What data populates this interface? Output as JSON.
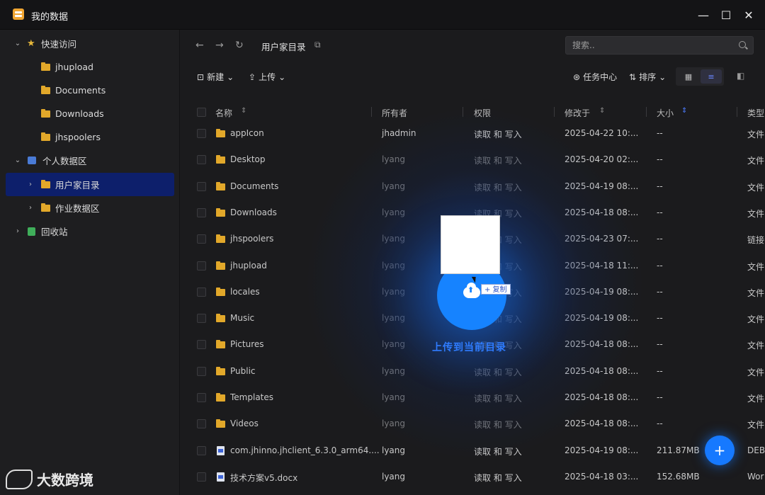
{
  "window": {
    "title": "我的数据"
  },
  "sidebar": {
    "quick": {
      "label": "快速访问"
    },
    "quick_items": [
      "jhupload",
      "Documents",
      "Downloads",
      "jhspoolers"
    ],
    "personal": {
      "label": "个人数据区"
    },
    "personal_items": [
      "用户家目录",
      "作业数据区"
    ],
    "trash": {
      "label": "回收站"
    }
  },
  "toolbar": {
    "breadcrumb": "用户家目录",
    "search_placeholder": "搜索..",
    "new_label": "新建",
    "upload_label": "上传",
    "tasks_label": "任务中心",
    "sort_label": "排序"
  },
  "table": {
    "headers": {
      "name": "名称",
      "owner": "所有者",
      "perm": "权限",
      "modified": "修改于",
      "size": "大小",
      "type": "类型"
    },
    "rows": [
      {
        "name": "appIcon",
        "owner": "jhadmin",
        "perm": "读取 和 写入",
        "modified": "2025-04-22 10:...",
        "size": "--",
        "type": "文件"
      },
      {
        "name": "Desktop",
        "owner": "lyang",
        "perm": "读取 和 写入",
        "modified": "2025-04-20 02:...",
        "size": "--",
        "type": "文件"
      },
      {
        "name": "Documents",
        "owner": "lyang",
        "perm": "读取 和 写入",
        "modified": "2025-04-19 08:...",
        "size": "--",
        "type": "文件"
      },
      {
        "name": "Downloads",
        "owner": "lyang",
        "perm": "读取 和 写入",
        "modified": "2025-04-18 08:...",
        "size": "--",
        "type": "文件"
      },
      {
        "name": "jhspoolers",
        "owner": "lyang",
        "perm": "读取 和 写入",
        "modified": "2025-04-23 07:...",
        "size": "--",
        "type": "链接"
      },
      {
        "name": "jhupload",
        "owner": "lyang",
        "perm": "读取 和 写入",
        "modified": "2025-04-18 11:...",
        "size": "--",
        "type": "文件"
      },
      {
        "name": "locales",
        "owner": "lyang",
        "perm": "读取 和 写入",
        "modified": "2025-04-19 08:...",
        "size": "--",
        "type": "文件"
      },
      {
        "name": "Music",
        "owner": "lyang",
        "perm": "读取 和 写入",
        "modified": "2025-04-19 08:...",
        "size": "--",
        "type": "文件"
      },
      {
        "name": "Pictures",
        "owner": "lyang",
        "perm": "读取 和 写入",
        "modified": "2025-04-18 08:...",
        "size": "--",
        "type": "文件"
      },
      {
        "name": "Public",
        "owner": "lyang",
        "perm": "读取 和 写入",
        "modified": "2025-04-18 08:...",
        "size": "--",
        "type": "文件"
      },
      {
        "name": "Templates",
        "owner": "lyang",
        "perm": "读取 和 写入",
        "modified": "2025-04-18 08:...",
        "size": "--",
        "type": "文件"
      },
      {
        "name": "Videos",
        "owner": "lyang",
        "perm": "读取 和 写入",
        "modified": "2025-04-18 08:...",
        "size": "--",
        "type": "文件"
      },
      {
        "name": "com.jhinno.jhclient_6.3.0_arm64....",
        "owner": "lyang",
        "perm": "读取 和 写入",
        "modified": "2025-04-19 08:...",
        "size": "211.87MB",
        "type": "DEB"
      },
      {
        "name": "技术方案v5.docx",
        "owner": "lyang",
        "perm": "读取 和 写入",
        "modified": "2025-04-18 03:...",
        "size": "152.68MB",
        "type": "Wor"
      }
    ]
  },
  "drag": {
    "copy_label": "+ 复制",
    "drop_text": "上传到当前目录"
  },
  "watermark": {
    "text": "大数跨境"
  },
  "colors": {
    "accent": "#1679ff",
    "selected": "#0d1f6b",
    "folder": "#e2a82a"
  }
}
